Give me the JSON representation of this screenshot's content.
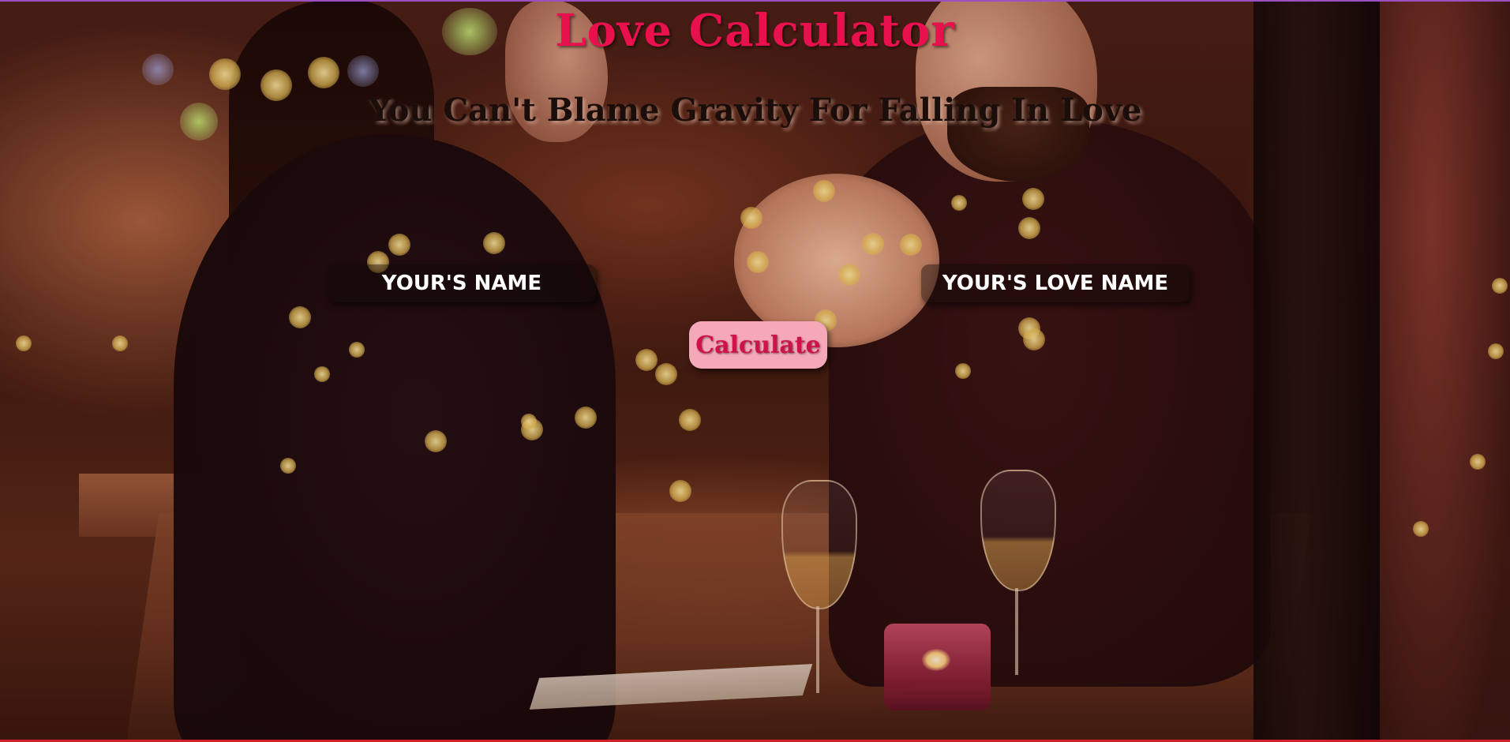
{
  "page": {
    "title": "Love Calculator",
    "subtitle": "You Can't Blame Gravity For Falling In Love"
  },
  "form": {
    "your_name_placeholder": "YOUR'S NAME",
    "your_name_value": "",
    "love_name_placeholder": "YOUR'S LOVE NAME",
    "love_name_value": "",
    "calculate_label": "Calculate"
  },
  "background": {
    "image": "couple-holding-hands-restaurant-photo"
  },
  "colors": {
    "title": "#e8104d",
    "button_bg": "#f4a8b8",
    "button_text": "#d0124a",
    "input_bg": "rgba(15,8,6,0.45)"
  }
}
